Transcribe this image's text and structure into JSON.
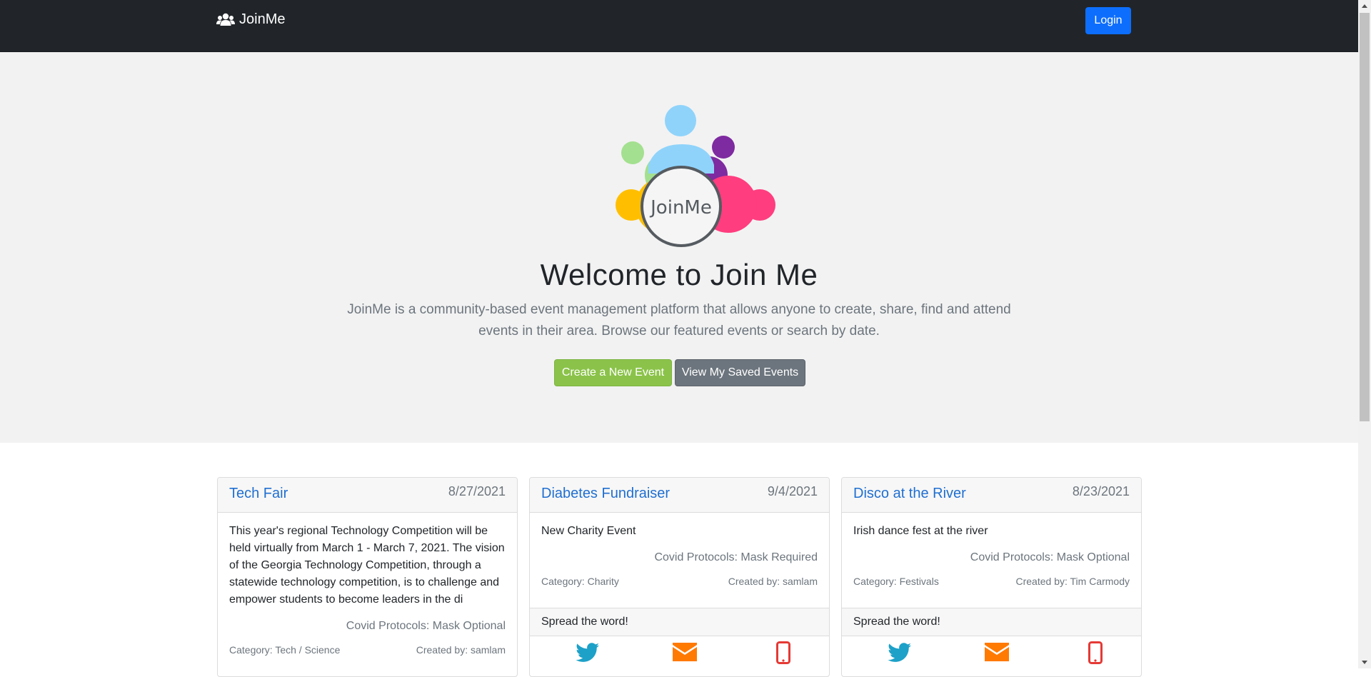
{
  "colors": {
    "navbar": "#212529",
    "login": "#0d6efd",
    "create_button": "#8bc34a",
    "saved_button": "#6c757d",
    "title_link": "#1f6fd1",
    "twitter": "#1da1c8",
    "email": "#ff7a00",
    "phone": "#e53935"
  },
  "nav": {
    "brand": "JoinMe",
    "brand_icon": "users-icon",
    "login_label": "Login"
  },
  "hero": {
    "logo_text": "JoinMe",
    "title": "Welcome to Join Me",
    "lead_line1": "JoinMe is a community-based event management platform that allows anyone to create, share, find and attend",
    "lead_line2": "events in their area. Browse our featured events or search by date.",
    "create_label": "Create a New Event",
    "saved_label": "View My Saved Events"
  },
  "events": [
    {
      "title": "Tech Fair",
      "date": "8/27/2021",
      "description": "This year's regional Technology Competition will be held virtually from March 1 - March 7, 2021. The vision of the Georgia Technology Competition, through a statewide technology competition, is to challenge and empower students to become leaders in the di",
      "covid": "Covid Protocols: Mask Optional",
      "category": "Category: Tech / Science",
      "created_by": "Created by: samlam"
    },
    {
      "title": "Diabetes Fundraiser",
      "date": "9/4/2021",
      "description": "New Charity Event",
      "covid": "Covid Protocols: Mask Required",
      "category": "Category: Charity",
      "created_by": "Created by: samlam",
      "share_label": "Spread the word!"
    },
    {
      "title": "Disco at the River",
      "date": "8/23/2021",
      "description": "Irish dance fest at the river",
      "covid": "Covid Protocols: Mask Optional",
      "category": "Category: Festivals",
      "created_by": "Created by: Tim Carmody",
      "share_label": "Spread the word!"
    }
  ],
  "share_icons": [
    "twitter-icon",
    "email-icon",
    "phone-icon"
  ]
}
